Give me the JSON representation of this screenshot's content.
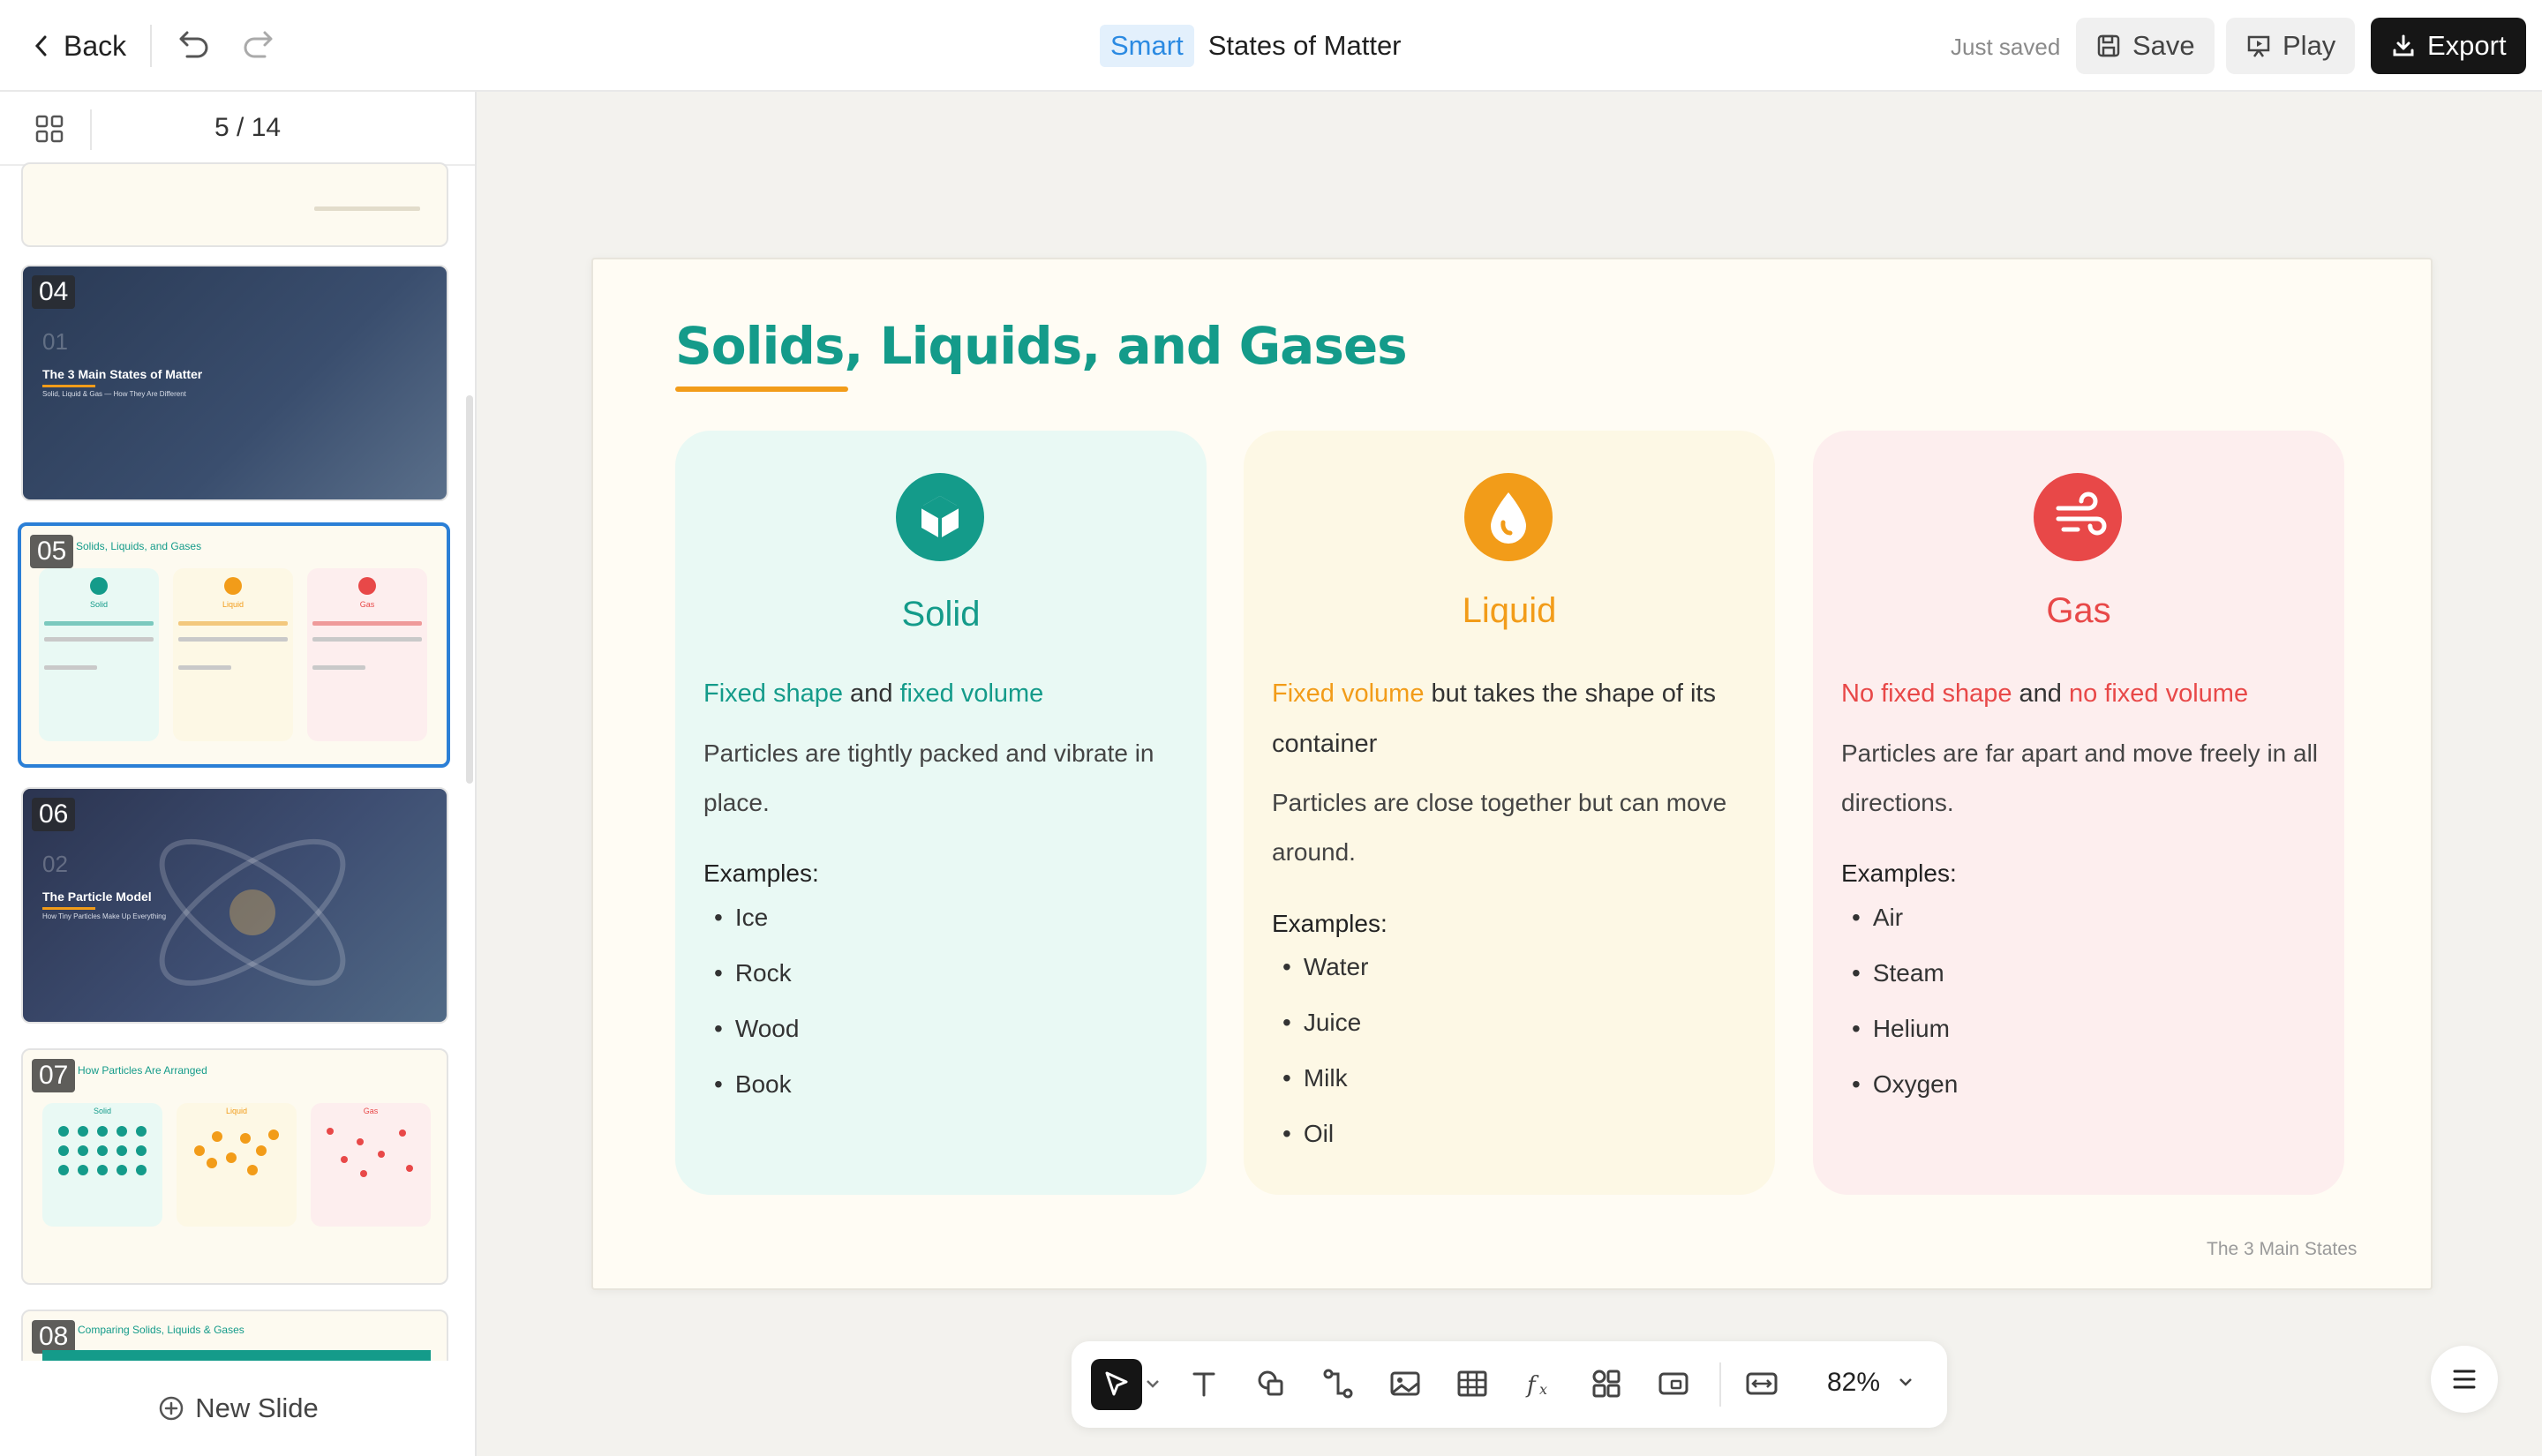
{
  "header": {
    "back_label": "Back",
    "badge": "Smart",
    "doc_title": "States of Matter",
    "save_status": "Just saved",
    "save_label": "Save",
    "play_label": "Play",
    "export_label": "Export"
  },
  "sidebar": {
    "counter": "5 / 14",
    "thumbnails": [
      {
        "num": "04",
        "big": "01",
        "title": "The 3 Main States of Matter",
        "subtitle": "Solid, Liquid & Gas — How They Are Different"
      },
      {
        "num": "05",
        "title": "Solids, Liquids, and Gases",
        "cols": [
          "Solid",
          "Liquid",
          "Gas"
        ]
      },
      {
        "num": "06",
        "big": "02",
        "title": "The Particle Model",
        "subtitle": "How Tiny Particles Make Up Everything"
      },
      {
        "num": "07",
        "title": "How Particles Are Arranged",
        "cols": [
          "Solid",
          "Liquid",
          "Gas"
        ]
      },
      {
        "num": "08",
        "title": "Comparing Solids, Liquids & Gases"
      }
    ],
    "new_slide_label": "New Slide"
  },
  "slide": {
    "title": "Solids, Liquids, and Gases",
    "footer": "The 3 Main States",
    "cards": [
      {
        "name": "Solid",
        "lead_hl1": "Fixed shape",
        "lead_mid": " and ",
        "lead_hl2": "fixed volume",
        "lead_rest": "",
        "desc": "Particles are tightly packed and vibrate in place.",
        "examples_label": "Examples:",
        "examples": [
          "Ice",
          "Rock",
          "Wood",
          "Book"
        ],
        "color": "#149b8a"
      },
      {
        "name": "Liquid",
        "lead_hl1": "Fixed volume",
        "lead_mid": " but takes the shape of its container",
        "lead_hl2": "",
        "lead_rest": "",
        "desc": "Particles are close together but can move around.",
        "examples_label": "Examples:",
        "examples": [
          "Water",
          "Juice",
          "Milk",
          "Oil"
        ],
        "color": "#f29c19"
      },
      {
        "name": "Gas",
        "lead_hl1": "No fixed shape",
        "lead_mid": " and ",
        "lead_hl2": "no fixed volume",
        "lead_rest": "",
        "desc": "Particles are far apart and move freely in all directions.",
        "examples_label": "Examples:",
        "examples": [
          "Air",
          "Steam",
          "Helium",
          "Oxygen"
        ],
        "color": "#e84848"
      }
    ]
  },
  "toolbar": {
    "zoom": "82%",
    "tools": [
      "select-tool",
      "text-tool",
      "shape-tool",
      "connector-tool",
      "image-tool",
      "table-tool",
      "formula-tool",
      "components-tool",
      "embed-tool",
      "fit-tool"
    ]
  }
}
